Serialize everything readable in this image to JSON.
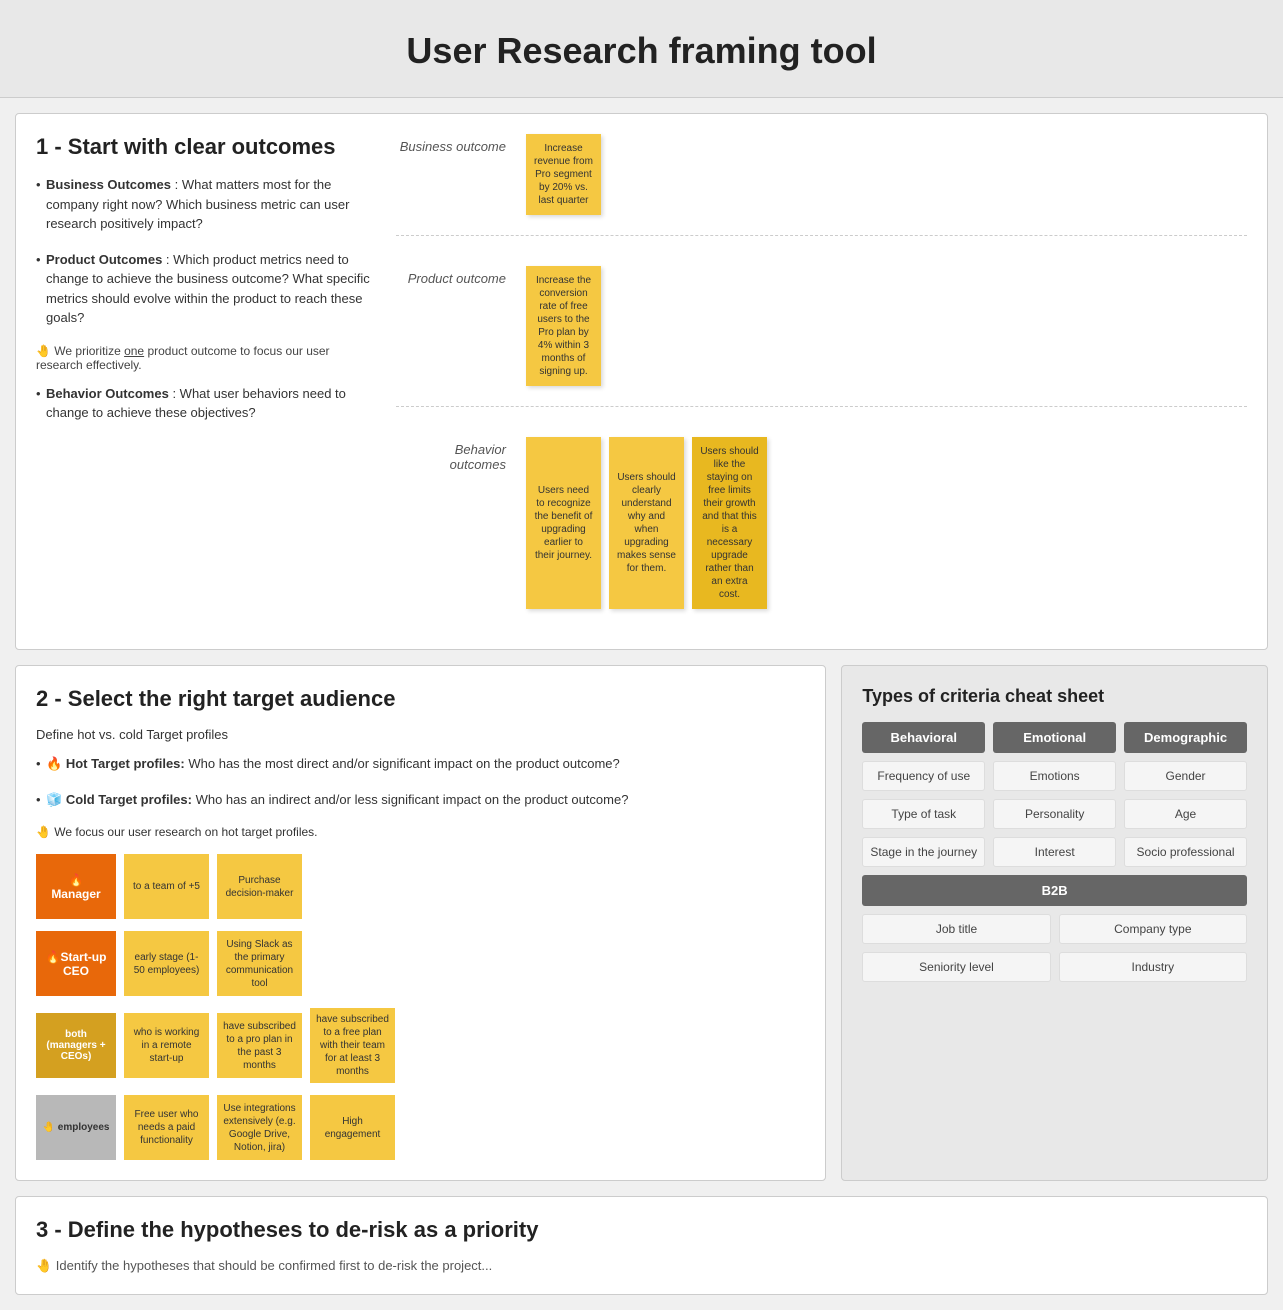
{
  "header": {
    "title": "User Research framing tool"
  },
  "section1": {
    "title": "1 - Start with clear outcomes",
    "bullets": [
      {
        "label": "Business Outcomes",
        "text": ": What matters most for the company right now? Which business metric can user research positively impact?"
      },
      {
        "label": "Product Outcomes",
        "text": ": Which product metrics need to change to achieve the business outcome? What specific metrics should evolve within the product to reach these goals?"
      },
      {
        "label": "Behavior Outcomes",
        "text": ": What user behaviors need to change to achieve these objectives?"
      }
    ],
    "note1": "🤚 We prioritize",
    "note1_underline": "one",
    "note1_end": "product outcome to focus our user research effectively.",
    "outcomes": [
      {
        "label": "Business outcome",
        "stickies": [
          "Increase revenue from Pro segment by 20% vs. last quarter"
        ]
      },
      {
        "label": "Product outcome",
        "stickies": [
          "Increase the conversion rate of free users to the Pro plan by 4% within 3 months of signing up."
        ]
      },
      {
        "label": "Behavior outcomes",
        "stickies": [
          "Users need to recognize the benefit of upgrading earlier to their journey.",
          "Users should clearly understand why and when upgrading makes sense for them.",
          "Users should like the staying on free limits their growth and that this is a necessary upgrade rather than an extra cost."
        ]
      }
    ]
  },
  "section2": {
    "title": "2 - Select the right target audience",
    "subtitle": "Define hot vs. cold Target profiles",
    "bullets": [
      {
        "emoji": "🔥",
        "label": "Hot Target profiles:",
        "text": " Who has the most direct and/or significant impact on the product outcome?"
      },
      {
        "emoji": "🧊",
        "label": "Cold Target profiles:",
        "text": " Who has an indirect and/or less significant impact on the product outcome?"
      }
    ],
    "note": "🤚 We focus our user research on hot target profiles.",
    "profiles": [
      {
        "main": "🔥\nManager",
        "cards": [
          "to a team of +5",
          "Purchase decision-maker"
        ]
      },
      {
        "main": "🔥Start-up CEO",
        "cards": [
          "early stage (1-50 employees)",
          "Using Slack as the primary communication tool"
        ]
      },
      {
        "main": "both (managers + CEOs)",
        "cards": [
          "who is working in a remote start-up",
          "have subscribed to a pro plan in the past 3 months",
          "have subscribed to a free plan with their team for at least 3 months"
        ]
      },
      {
        "main": "🤚 employees",
        "cards": [
          "Free user who needs a paid functionality",
          "Use integrations extensively (e.g. Google Drive, Notion, jira)",
          "High engagement"
        ]
      }
    ],
    "cheatsheet": {
      "title": "Types of criteria cheat sheet",
      "columns": [
        "Behavioral",
        "Emotional",
        "Demographic"
      ],
      "rows": [
        [
          "Frequency of use",
          "Emotions",
          "Gender"
        ],
        [
          "Type of task",
          "Personality",
          "Age"
        ],
        [
          "Stage in the journey",
          "Interest",
          "Socio professional"
        ]
      ],
      "b2b_label": "B2B",
      "b2b_rows": [
        [
          "Job title",
          "Company type"
        ],
        [
          "Seniority level",
          "Industry"
        ]
      ]
    }
  },
  "section3": {
    "title": "3 - Define the hypotheses to de-risk as a priority"
  }
}
